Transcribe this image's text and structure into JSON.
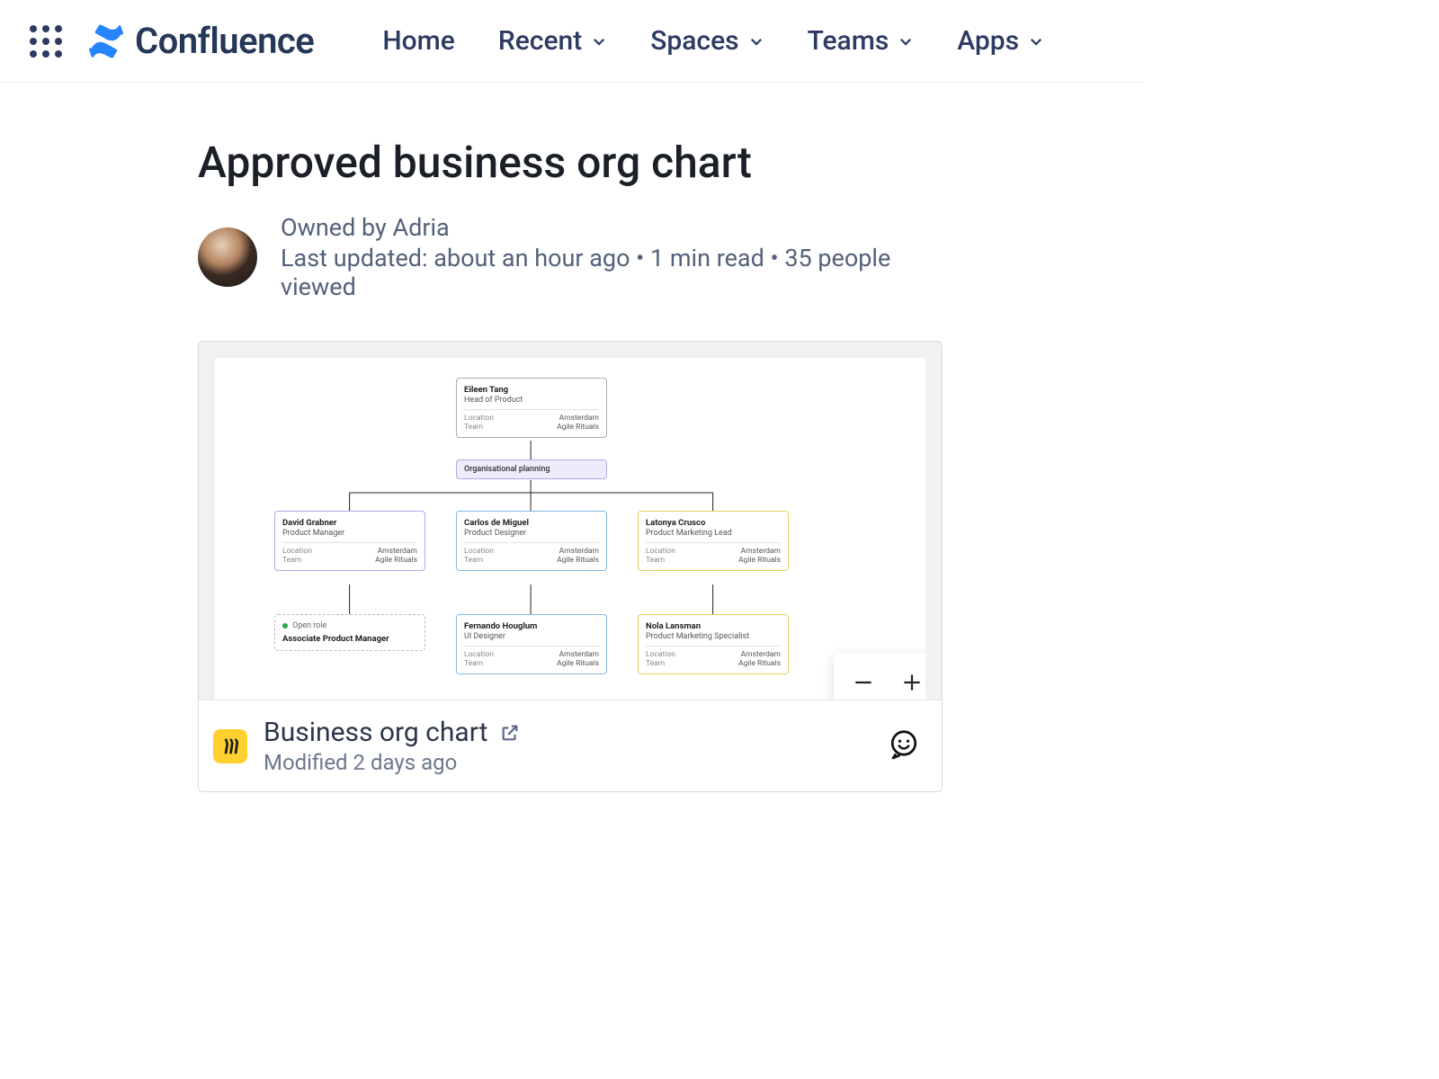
{
  "nav": {
    "brand": "Confluence",
    "items": [
      "Home",
      "Recent",
      "Spaces",
      "Teams",
      "Apps"
    ],
    "dropdown_flags": [
      false,
      true,
      true,
      true,
      true
    ]
  },
  "page": {
    "title": "Approved business org chart",
    "owner_line": "Owned by Adria",
    "meta_line": "Last updated: about an hour ago • 1 min read • 35 people viewed"
  },
  "embed": {
    "title": "Business org chart",
    "modified": "Modified 2 days ago"
  },
  "org": {
    "planning_label": "Organisational planning",
    "field_labels": {
      "location": "Location",
      "team": "Team"
    },
    "open_role": {
      "pill": "Open role",
      "title": "Associate Product Manager"
    },
    "nodes": {
      "head": {
        "name": "Eileen Tang",
        "role": "Head of Product",
        "location": "Amsterdam",
        "team": "Agile Rituals"
      },
      "pm": {
        "name": "David Grabner",
        "role": "Product Manager",
        "location": "Amsterdam",
        "team": "Agile Rituals"
      },
      "pd": {
        "name": "Carlos de Miguel",
        "role": "Product Designer",
        "location": "Amsterdam",
        "team": "Agile Rituals"
      },
      "pml": {
        "name": "Latonya Crusco",
        "role": "Product Marketing Lead",
        "location": "Amsterdam",
        "team": "Agile Rituals"
      },
      "ui": {
        "name": "Fernando Houglum",
        "role": "UI Designer",
        "location": "Amsterdam",
        "team": "Agile Rituals"
      },
      "pms": {
        "name": "Nola Lansman",
        "role": "Product Marketing Specialist",
        "location": "Amsterdam",
        "team": "Agile Rituals"
      }
    }
  }
}
